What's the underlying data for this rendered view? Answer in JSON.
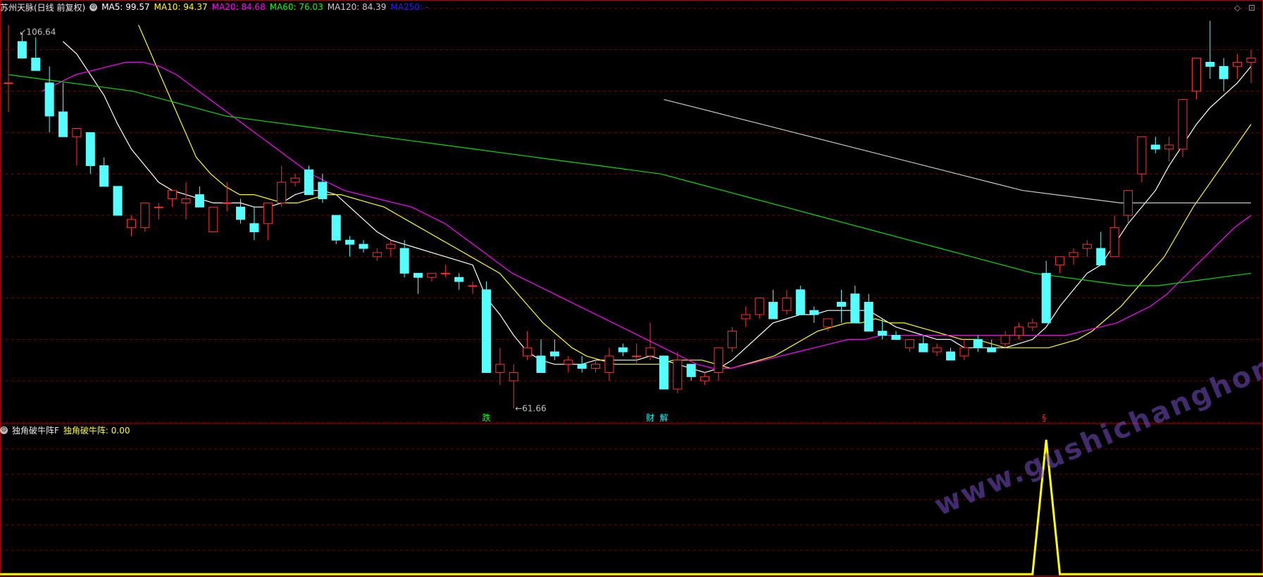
{
  "header": {
    "title": "苏州天脉(日线 前复权)",
    "ma": [
      {
        "label": "MA5: 99.57",
        "color": "#ffffff"
      },
      {
        "label": "MA10: 94.37",
        "color": "#ffff00"
      },
      {
        "label": "MA20: 84.68",
        "color": "#ff00ff"
      },
      {
        "label": "MA60: 76.03",
        "color": "#00ff00"
      },
      {
        "label": "MA120: 84.39",
        "color": "#c8c8c8"
      },
      {
        "label": "MA250: -",
        "color": "#0000ff"
      }
    ]
  },
  "sub_header": {
    "name": "独角破牛阵F",
    "indicator": "独角破牛阵: 0.00"
  },
  "annotations": {
    "high": "106.64",
    "low": "61.66",
    "signals": [
      {
        "text": "跌",
        "color": "#00ff00"
      },
      {
        "text": "财",
        "color": "#00ffff"
      },
      {
        "text": "解",
        "color": "#00ffff"
      },
      {
        "text": "§",
        "color": "#ff2020"
      }
    ]
  },
  "watermark": "www.gushichanghong.com",
  "colors": {
    "up": "#ff3030",
    "down": "#55ffff",
    "grid": "#7a0000",
    "signal": "#ffff00",
    "panel_border": "#b00000"
  },
  "chart_data": {
    "type": "candlestick",
    "price_range": [
      60,
      110
    ],
    "candles": [
      [
        101,
        108,
        97.5,
        101
      ],
      [
        106,
        107,
        104,
        104
      ],
      [
        104,
        106.5,
        102.5,
        102.5
      ],
      [
        101,
        103,
        95,
        97
      ],
      [
        97.5,
        101,
        94.5,
        94.5
      ],
      [
        94.5,
        95.5,
        91,
        95.5
      ],
      [
        95,
        95,
        90,
        91
      ],
      [
        91,
        92,
        88.5,
        88.5
      ],
      [
        88.5,
        88.5,
        85,
        85
      ],
      [
        83.5,
        85,
        82.5,
        84.5
      ],
      [
        83.5,
        86.5,
        83,
        86.5
      ],
      [
        86,
        86.5,
        84.5,
        86
      ],
      [
        87,
        88,
        86,
        88
      ],
      [
        86.5,
        89,
        84.5,
        87
      ],
      [
        87.5,
        88.5,
        86,
        86
      ],
      [
        83,
        86,
        83,
        86
      ],
      [
        86.5,
        89,
        85.5,
        86.5
      ],
      [
        86,
        87,
        84,
        84.5
      ],
      [
        84,
        86,
        82,
        83
      ],
      [
        84,
        86.5,
        82,
        86.5
      ],
      [
        86.5,
        91,
        86,
        89
      ],
      [
        89,
        90,
        88.5,
        89.5
      ],
      [
        90.5,
        91,
        87.5,
        87.5
      ],
      [
        89,
        90,
        86.5,
        87
      ],
      [
        85,
        85,
        81.5,
        82
      ],
      [
        82,
        82.5,
        80,
        81.5
      ],
      [
        81.5,
        82,
        80.5,
        81
      ],
      [
        80,
        81,
        79.5,
        80.5
      ],
      [
        81,
        82,
        80,
        81.5
      ],
      [
        81,
        82,
        77.5,
        78
      ],
      [
        78,
        78,
        75.5,
        77.5
      ],
      [
        77.5,
        78,
        77,
        78
      ],
      [
        78,
        79,
        77.5,
        78
      ],
      [
        77.5,
        78,
        76,
        77
      ],
      [
        76.5,
        77,
        75.5,
        76.5
      ],
      [
        76,
        77,
        67,
        66
      ],
      [
        66,
        69,
        64.5,
        67
      ],
      [
        65,
        67,
        61.66,
        66
      ],
      [
        68,
        71,
        67.5,
        69
      ],
      [
        68,
        70,
        66,
        66
      ],
      [
        68.5,
        70,
        67.5,
        68
      ],
      [
        67,
        68,
        66,
        67.5
      ],
      [
        67,
        68,
        66,
        66.5
      ],
      [
        66.5,
        67.5,
        66,
        67
      ],
      [
        66,
        69,
        65,
        68
      ],
      [
        69,
        69.5,
        68,
        68.5
      ],
      [
        68,
        69.5,
        67,
        68
      ],
      [
        68,
        72,
        67.5,
        69
      ],
      [
        68,
        68,
        64,
        64
      ],
      [
        64,
        68.5,
        63.5,
        67.5
      ],
      [
        67,
        67,
        65,
        65.5
      ],
      [
        65,
        66,
        64.5,
        65.5
      ],
      [
        66,
        69,
        65,
        69
      ],
      [
        69,
        71.5,
        68.5,
        71
      ],
      [
        72.5,
        74,
        71.5,
        73
      ],
      [
        73,
        75,
        72.5,
        75
      ],
      [
        74.5,
        76,
        72.5,
        72.5
      ],
      [
        73.5,
        76,
        73,
        75
      ],
      [
        76,
        76.5,
        73,
        73
      ],
      [
        73.5,
        74,
        72,
        73
      ],
      [
        71.5,
        72.5,
        71,
        72.5
      ],
      [
        74.5,
        76,
        72,
        74
      ],
      [
        75.5,
        76.5,
        72,
        72
      ],
      [
        74.5,
        75.5,
        71,
        71
      ],
      [
        71,
        72.5,
        70,
        70.5
      ],
      [
        70.5,
        71,
        70,
        70
      ],
      [
        69,
        70,
        68.5,
        70
      ],
      [
        69.5,
        70.5,
        68.5,
        68.5
      ],
      [
        68.5,
        69.5,
        68,
        69
      ],
      [
        68.5,
        69,
        67.5,
        67.5
      ],
      [
        68,
        70,
        67.5,
        69
      ],
      [
        70,
        70.5,
        68.5,
        69
      ],
      [
        69,
        70,
        68.5,
        68.5
      ],
      [
        69.5,
        71,
        69,
        70.5
      ],
      [
        70.5,
        72,
        70,
        71.5
      ],
      [
        71.5,
        72.5,
        71,
        72
      ],
      [
        78,
        79.5,
        72,
        72
      ],
      [
        79,
        80,
        78,
        80
      ],
      [
        80,
        81,
        79,
        80.5
      ],
      [
        81,
        82,
        80,
        81.5
      ],
      [
        81,
        83,
        79,
        79
      ],
      [
        80,
        85,
        80,
        83.5
      ],
      [
        85,
        88,
        84,
        88
      ],
      [
        90,
        93,
        89,
        94.5
      ],
      [
        93.5,
        94.5,
        92.5,
        93
      ],
      [
        93,
        94.5,
        91.5,
        93.5
      ],
      [
        93,
        99,
        92,
        99
      ],
      [
        100,
        103,
        99,
        104
      ],
      [
        103.5,
        108.5,
        101.5,
        103
      ],
      [
        103,
        104,
        100,
        101.5
      ],
      [
        103,
        104.5,
        101.5,
        103.5
      ],
      [
        103.5,
        105,
        101,
        104
      ]
    ],
    "ma_series": {
      "MA5": [
        null,
        null,
        null,
        null,
        106,
        104.5,
        102,
        99.5,
        96,
        93,
        91,
        89,
        88,
        87.5,
        87,
        86.5,
        86.5,
        86.5,
        86,
        86,
        86.5,
        87.5,
        88,
        88,
        87.5,
        86,
        84.5,
        83,
        82,
        81.5,
        81,
        80.5,
        80,
        79.5,
        79,
        75,
        73,
        70.5,
        68.5,
        67.5,
        67,
        67,
        67,
        67.5,
        67.5,
        67.5,
        67.5,
        68,
        67.5,
        67,
        66.5,
        66,
        66.5,
        67.5,
        69,
        70.5,
        72,
        72.5,
        73,
        73,
        73.5,
        73.5,
        73.5,
        73.5,
        72.5,
        71.5,
        71,
        70.5,
        70,
        70,
        69,
        69,
        69,
        69,
        69.5,
        70,
        71.5,
        74,
        76,
        78,
        79,
        81.5,
        84,
        86,
        88,
        91,
        93.5,
        96,
        98,
        99.5,
        101,
        103
      ],
      "MA10": [
        null,
        null,
        null,
        null,
        null,
        null,
        null,
        null,
        null,
        108,
        104,
        100,
        96,
        92,
        90,
        88.5,
        87.5,
        87.5,
        87,
        86.5,
        86.5,
        87,
        87.5,
        87.5,
        87,
        86.5,
        86,
        85,
        84,
        83,
        82,
        81,
        80,
        79,
        78,
        76,
        74,
        72,
        70.5,
        69,
        68,
        67.5,
        67,
        67,
        67,
        67,
        67.5,
        67.5,
        67.5,
        67,
        66.5,
        67,
        67.5,
        68,
        69,
        70,
        71,
        71.5,
        72,
        72,
        72.5,
        72,
        72,
        71.5,
        71,
        70.5,
        70,
        70,
        69.5,
        69,
        69,
        69,
        69,
        69.5,
        70,
        71,
        72.5,
        74,
        76,
        78,
        80,
        83,
        86,
        88.5,
        91,
        93.5,
        96
      ],
      "MA20": [
        null,
        null,
        100,
        101,
        102,
        102.5,
        103,
        103.5,
        103.5,
        103,
        102,
        100.5,
        99,
        97.5,
        96,
        94.5,
        93,
        91.5,
        90,
        89,
        88,
        87.5,
        87,
        86.5,
        86,
        85,
        84,
        82.5,
        81,
        79.5,
        78,
        77,
        76,
        75,
        74,
        73,
        72,
        71,
        70,
        69,
        68,
        67,
        66.5,
        66.5,
        67,
        67.5,
        68,
        68.5,
        69,
        69.5,
        70,
        70,
        70.5,
        70.5,
        70.5,
        70.5,
        70.5,
        70.5,
        70.5,
        70.5,
        70.5,
        70.5,
        70.5,
        70.5,
        71,
        71.5,
        72,
        73,
        74,
        75.5,
        77.5,
        79.5,
        81.5,
        83.5,
        85
      ],
      "MA60": [
        102,
        101.5,
        101,
        100.5,
        100,
        99,
        98,
        97,
        96.5,
        96,
        95.5,
        95,
        94.5,
        94,
        93.5,
        93,
        92.5,
        92,
        91.5,
        91,
        90.5,
        90,
        89,
        88,
        87,
        86,
        85,
        84,
        83,
        82,
        81,
        80,
        79,
        78,
        77.5,
        77,
        76.5,
        76.5,
        77,
        77.5,
        78
      ],
      "MA120": [
        99,
        98,
        97,
        96,
        95,
        94,
        93,
        92,
        91,
        90,
        89,
        88,
        87.5,
        87,
        86.5,
        86.5,
        86.5,
        86.5,
        86.5
      ]
    },
    "indicator": {
      "name": "独角破牛阵",
      "peak_index": 76,
      "peak_value": 1,
      "value": 0
    }
  }
}
